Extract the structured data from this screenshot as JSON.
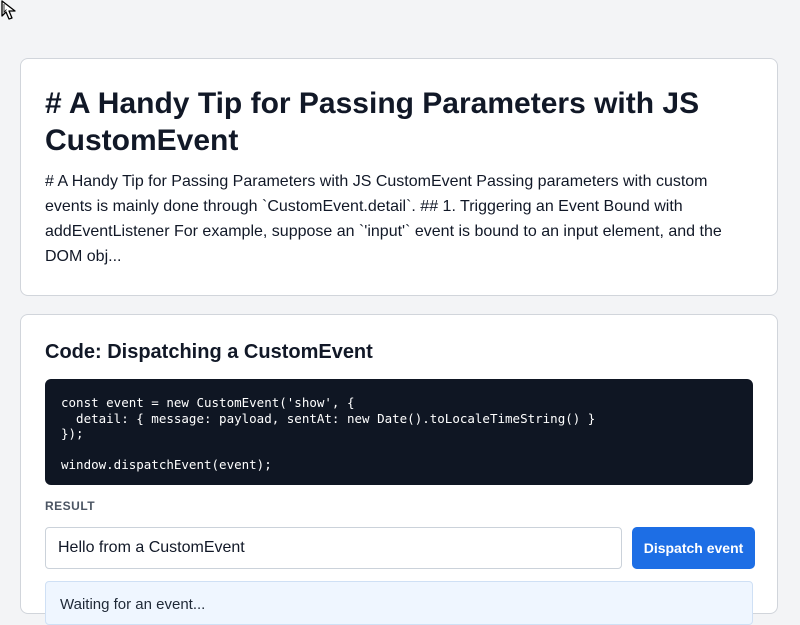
{
  "article": {
    "title": "# A Handy Tip for Passing Parameters with JS CustomEvent",
    "excerpt": "# A Handy Tip for Passing Parameters with JS CustomEvent Passing parameters with custom events is mainly done through `CustomEvent.detail`. ## 1. Triggering an Event Bound with addEventListener For example, suppose an `'input'` event is bound to an input element, and the DOM obj..."
  },
  "demo": {
    "title": "Code: Dispatching a CustomEvent",
    "code": "const event = new CustomEvent('show', {\n  detail: { message: payload, sentAt: new Date().toLocaleTimeString() }\n});\n\nwindow.dispatchEvent(event);",
    "result_label": "RESULT",
    "input_value": "Hello from a CustomEvent",
    "button_label": "Dispatch event",
    "status_text": "Waiting for an event..."
  },
  "colors": {
    "accent": "#1d6ee5",
    "code_bg": "#0f1623",
    "status_bg": "#eff6ff"
  },
  "icons": {
    "cursor": "arrow-cursor-icon"
  }
}
